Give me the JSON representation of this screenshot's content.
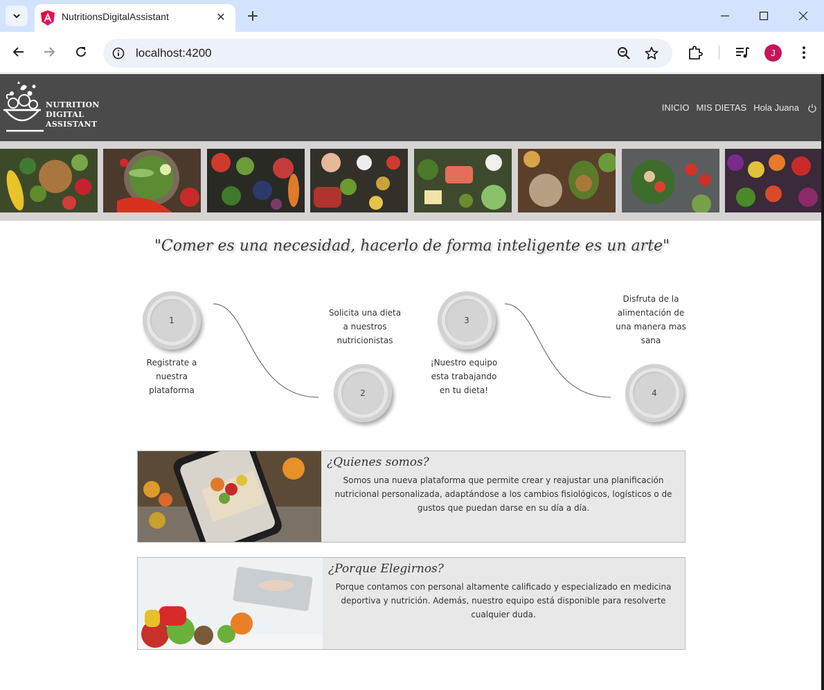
{
  "browser": {
    "tab_title": "NutritionsDigitalAssistant",
    "url": "localhost:4200",
    "avatar_initial": "J",
    "accent_color": "#c2185b"
  },
  "header": {
    "logo_lines": [
      "NUTRITION",
      "DIGITAL",
      "ASSISTANT"
    ],
    "nav": [
      "INICIO",
      "MIS DIETAS",
      "Hola Juana"
    ],
    "background": "#4a4a4a"
  },
  "banner": {
    "tiles": [
      "vegetables-fruits",
      "salad-bowl",
      "fresh-produce",
      "meat-fish-veg",
      "salmon-veg",
      "grains-avocado",
      "chickpea-bowl",
      "rainbow-produce"
    ]
  },
  "quote": "\"Comer es una necesidad, hacerlo de forma inteligente es un arte\"",
  "steps": [
    {
      "number": "1",
      "text": "Registrate a nuestra plataforma"
    },
    {
      "number": "2",
      "text": "Solicita una dieta a nuestros nutricionistas"
    },
    {
      "number": "3",
      "text": "¡Nuestro equipo esta trabajando en tu dieta!"
    },
    {
      "number": "4",
      "text": "Disfruta de la alimentación de una manera mas sana"
    }
  ],
  "cards": [
    {
      "title": "¿Quienes somos?",
      "body": "Somos una nueva plataforma que permite crear y reajustar una planificación nutricional personalizada, adaptándose a los cambios fisiológicos, logísticos o de gustos que puedan darse en su día a día."
    },
    {
      "title": "¿Porque Elegirnos?",
      "body": "Porque contamos con personal altamente calificado y especializado en medicina deportiva y nutrición. Además, nuestro equipo está disponible para resolverte cualquier duda."
    }
  ]
}
